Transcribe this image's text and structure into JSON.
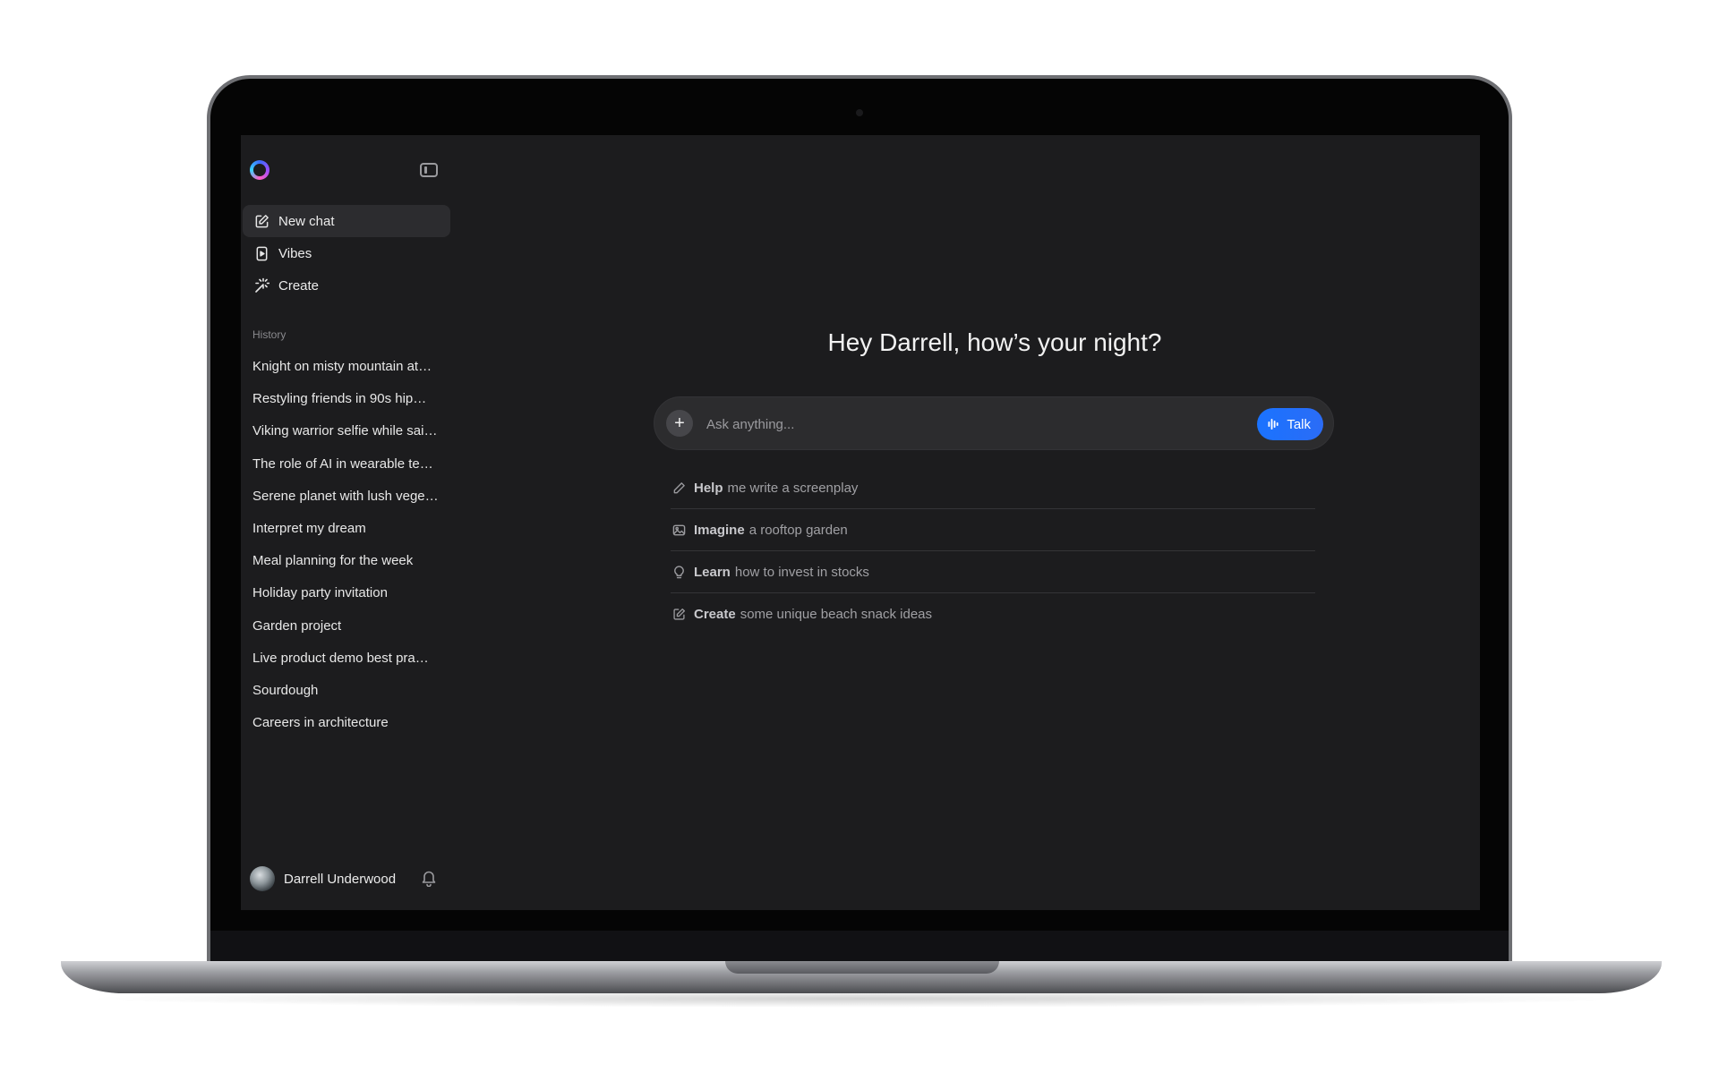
{
  "sidebar": {
    "nav": [
      {
        "label": "New chat",
        "icon": "compose-icon"
      },
      {
        "label": "Vibes",
        "icon": "video-icon"
      },
      {
        "label": "Create",
        "icon": "magic-wand-icon"
      }
    ],
    "history_label": "History",
    "history": [
      "Knight on misty mountain at…",
      "Restyling friends in 90s hip…",
      "Viking warrior selfie while sai…",
      "The role of AI in wearable te…",
      "Serene planet with lush vege…",
      "Interpret my dream",
      "Meal planning for the week",
      "Holiday party invitation",
      "Garden project",
      "Live product demo best pra…",
      "Sourdough",
      "Careers in architecture"
    ],
    "user_name": "Darrell Underwood"
  },
  "main": {
    "greeting": "Hey Darrell, how’s your night?",
    "composer": {
      "placeholder": "Ask anything...",
      "talk_label": "Talk"
    },
    "suggestions": [
      {
        "bold": "Help",
        "rest": "me write a screenplay",
        "icon": "pencil-icon"
      },
      {
        "bold": "Imagine",
        "rest": "a rooftop garden",
        "icon": "image-icon"
      },
      {
        "bold": "Learn",
        "rest": "how to invest in stocks",
        "icon": "lightbulb-icon"
      },
      {
        "bold": "Create",
        "rest": "some unique beach snack ideas",
        "icon": "compose-icon"
      }
    ]
  },
  "colors": {
    "background": "#1c1c1e",
    "accent": "#1a73ff",
    "composer": "#2c2c2e"
  }
}
